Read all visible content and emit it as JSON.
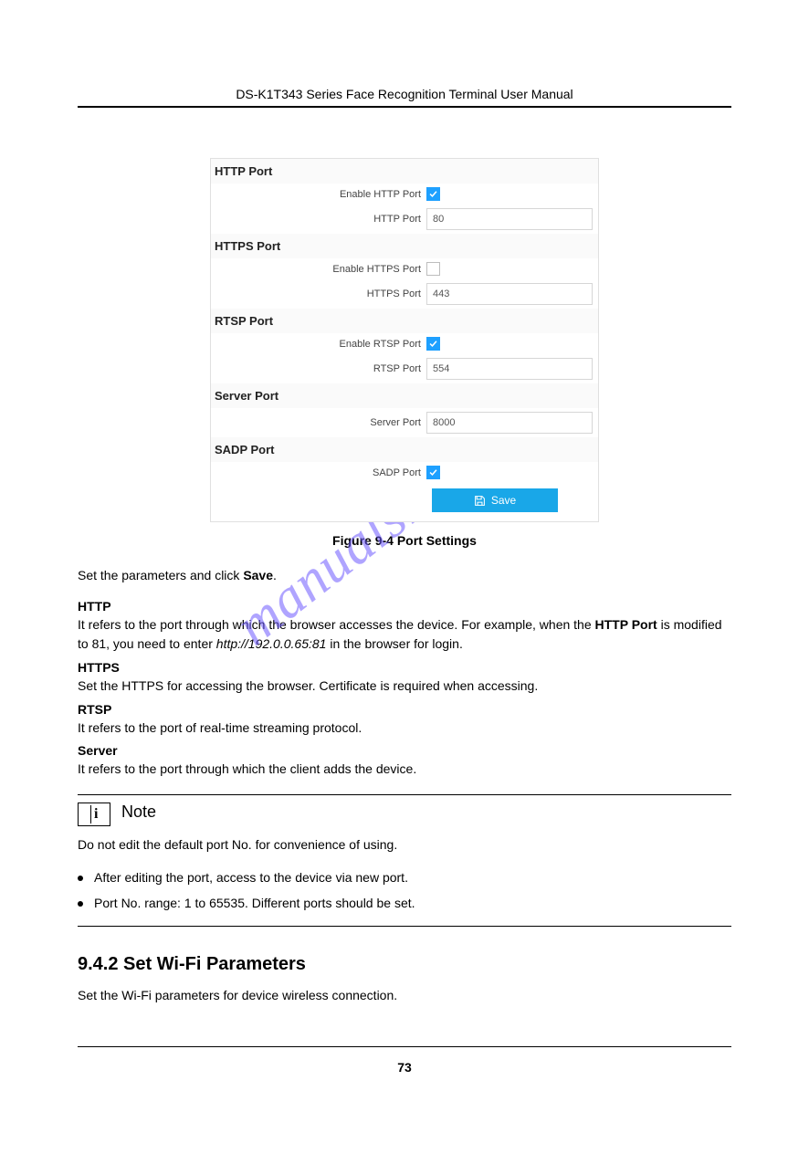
{
  "doc": {
    "title": "DS-K1T343 Series Face Recognition Terminal User Manual",
    "figure_caption": "Figure 9-4 Port Settings",
    "intro": "Set the parameters and click Save.",
    "defs": [
      {
        "term": "HTTP",
        "body": "It refers to the port through which the browser accesses the device. For example, when the HTTP Port is modified to 81, you need to enter http://192.0.0.65:81 in the browser for login."
      },
      {
        "term": "HTTPS",
        "body": "Set the HTTPS for accessing the browser. Certificate is required when accessing."
      },
      {
        "term": "RTSP",
        "body": "It refers to the port of real-time streaming protocol."
      },
      {
        "term": "Server",
        "body": "It refers to the port through which the client adds the device."
      }
    ],
    "note": {
      "heading": "Note",
      "body": "Do not edit the default port No. for convenience of using.",
      "bullets": [
        "After editing the port, access to the device via new port.",
        "Port No. range: 1 to 65535. Different ports should be set."
      ]
    },
    "section_heading": "9.4.2 Set Wi-Fi Parameters",
    "section_body": "Set the Wi-Fi parameters for device wireless connection.",
    "page_number": "73"
  },
  "panel": {
    "sections": [
      {
        "head": "HTTP Port",
        "rows": [
          {
            "label": "Enable HTTP Port",
            "type": "checkbox",
            "checked": true
          },
          {
            "label": "HTTP Port",
            "type": "text",
            "value": "80"
          }
        ]
      },
      {
        "head": "HTTPS Port",
        "rows": [
          {
            "label": "Enable HTTPS Port",
            "type": "checkbox",
            "checked": false
          },
          {
            "label": "HTTPS Port",
            "type": "text",
            "value": "443"
          }
        ]
      },
      {
        "head": "RTSP Port",
        "rows": [
          {
            "label": "Enable RTSP Port",
            "type": "checkbox",
            "checked": true
          },
          {
            "label": "RTSP Port",
            "type": "text",
            "value": "554"
          }
        ]
      },
      {
        "head": "Server Port",
        "rows": [
          {
            "label": "Server Port",
            "type": "text",
            "value": "8000"
          }
        ]
      },
      {
        "head": "SADP Port",
        "rows": [
          {
            "label": "SADP Port",
            "type": "checkbox",
            "checked": true
          }
        ]
      }
    ],
    "save_label": "Save"
  },
  "watermark": "manualshive.com"
}
